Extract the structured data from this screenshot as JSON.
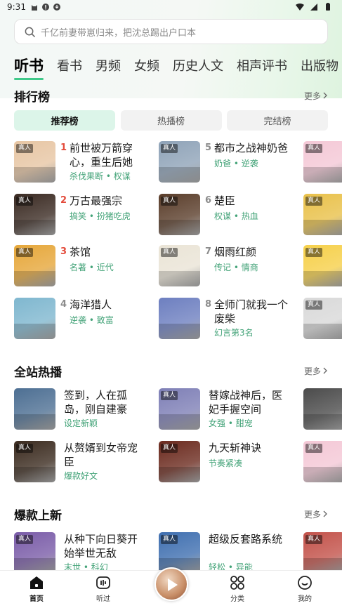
{
  "status_bar": {
    "time": "9:31"
  },
  "search": {
    "placeholder": "千亿前妻带崽归来，把沈总踢出户口本"
  },
  "tabs": [
    "听书",
    "看书",
    "男频",
    "女频",
    "历史人文",
    "相声评书",
    "出版物"
  ],
  "ranking": {
    "title": "排行榜",
    "more": "更多",
    "tabs": [
      "推荐榜",
      "热播榜",
      "完结榜"
    ],
    "items": [
      {
        "num": "1",
        "title": "前世被万箭穿心，重生后她",
        "tags": "杀伐果断 • 权谋",
        "badge": "真人",
        "color": "#e7c6a4"
      },
      {
        "num": "2",
        "title": "万古最强宗",
        "tags": "搞笑 • 扮猪吃虎",
        "badge": "真人",
        "color": "#3a2a22"
      },
      {
        "num": "3",
        "title": "茶馆",
        "tags": "名著 • 近代",
        "badge": "真人",
        "color": "#e6a73a"
      },
      {
        "num": "4",
        "title": "海洋猎人",
        "tags": "逆袭 • 致富",
        "badge": "",
        "color": "#7fb7cf"
      },
      {
        "num": "5",
        "title": "都市之战神奶爸",
        "tags": "奶爸 • 逆袭",
        "badge": "真人",
        "color": "#8fa3b8"
      },
      {
        "num": "6",
        "title": "楚臣",
        "tags": "权谋 • 热血",
        "badge": "真人",
        "color": "#5a3d2a"
      },
      {
        "num": "7",
        "title": "烟雨红颜",
        "tags": "传记 • 情商",
        "badge": "真人",
        "color": "#eae4d6"
      },
      {
        "num": "8",
        "title": "全师门就我一个废柴",
        "tags": "幻言第3名",
        "badge": "",
        "color": "#6d7fc0"
      }
    ],
    "peek": [
      {
        "badge": "真人",
        "color": "#f4c8d6"
      },
      {
        "badge": "真人",
        "color": "#e9c14a"
      },
      {
        "badge": "真人",
        "color": "#f6d04a"
      },
      {
        "badge": "真人",
        "color": "#d9d9d9"
      }
    ]
  },
  "hot": {
    "title": "全站热播",
    "more": "更多",
    "items": [
      {
        "title": "签到，人在孤岛，刚自建豪",
        "tags": "设定新颖",
        "badge": "",
        "color": "#4d6f93"
      },
      {
        "title": "从赘婿到女帝宠臣",
        "tags": "爆款好文",
        "badge": "真人",
        "color": "#3b2b1f"
      },
      {
        "title": "替嫁战神后，医妃手握空间",
        "tags": "女强 • 甜宠",
        "badge": "真人",
        "color": "#7e7fb6"
      },
      {
        "title": "九天斩神诀",
        "tags": "节奏紧凑",
        "badge": "真人",
        "color": "#6b2a1e"
      }
    ],
    "peek": [
      {
        "badge": "",
        "color": "#4b4b4b"
      },
      {
        "badge": "真人",
        "color": "#f4c8d6"
      }
    ]
  },
  "new": {
    "title": "爆款上新",
    "more": "更多",
    "items": [
      {
        "title": "从种下向日葵开始举世无敌",
        "tags": "末世 • 科幻",
        "badge": "真人",
        "color": "#7a5ca8"
      },
      {
        "title": "超级反套路系统",
        "tags": "轻松 • 异能",
        "badge": "真人",
        "color": "#3f6fb0"
      }
    ],
    "peek": [
      {
        "badge": "真人",
        "color": "#c3524a"
      }
    ]
  },
  "bottom_nav": [
    {
      "label": "首页",
      "icon": "home-icon",
      "active": true
    },
    {
      "label": "听过",
      "icon": "history-icon",
      "active": false
    },
    {
      "label": "分类",
      "icon": "category-icon",
      "active": false
    },
    {
      "label": "我的",
      "icon": "profile-icon",
      "active": false
    }
  ],
  "colors": {
    "accent": "#40c98a",
    "tag": "#43a378",
    "rank_red": "#e34b3b",
    "rank_gray": "#8c8c8c"
  }
}
